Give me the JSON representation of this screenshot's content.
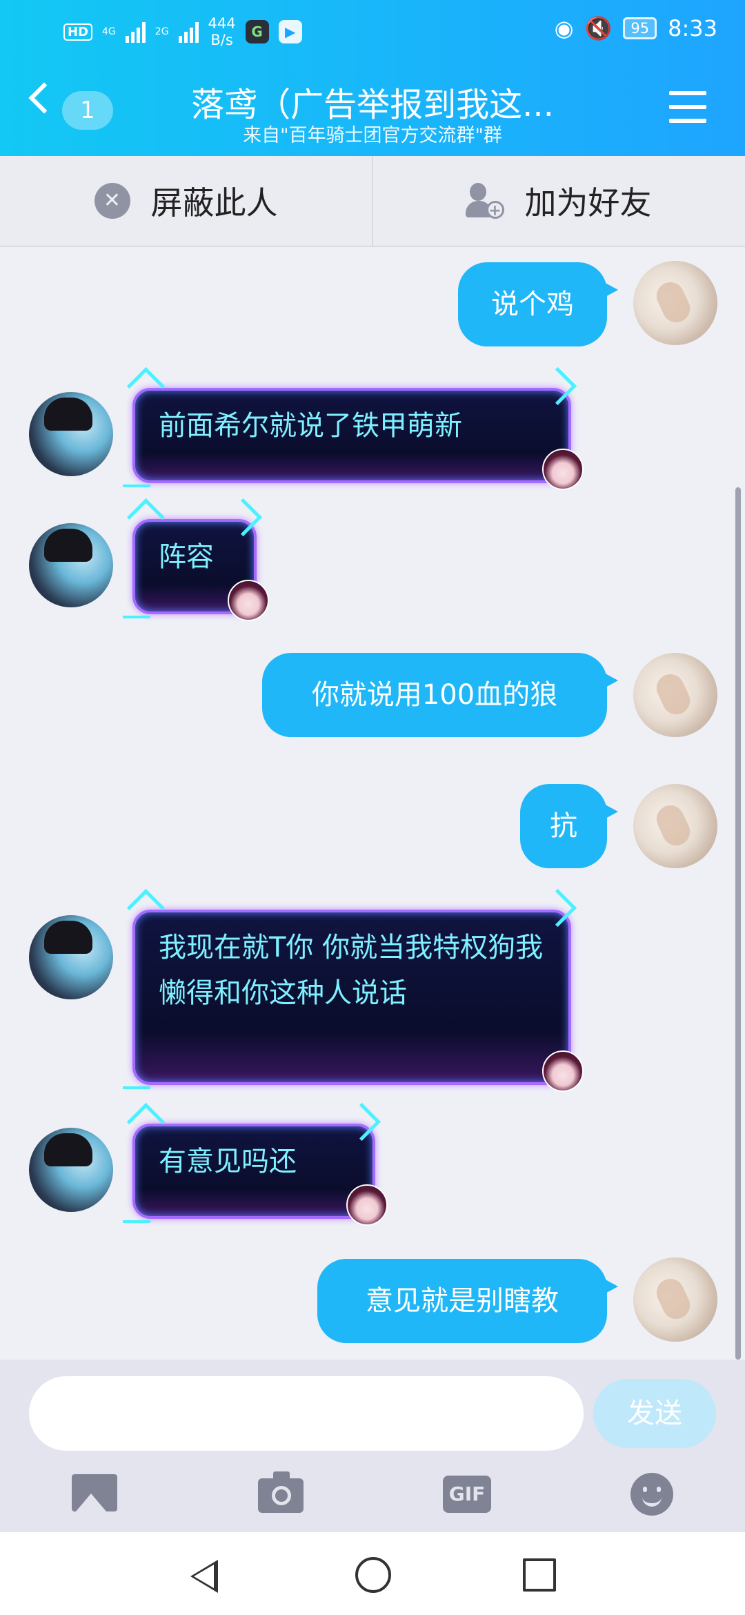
{
  "status": {
    "hd": "HD",
    "net1": "4G",
    "net2": "2G",
    "speed_value": "444",
    "speed_unit": "B/s",
    "app1": "G",
    "battery": "95",
    "time": "8:33"
  },
  "header": {
    "unread_count": "1",
    "title": "落鸢（广告举报到我这...",
    "subtitle": "来自\"百年骑士团官方交流群\"群"
  },
  "actions": {
    "block": "屏蔽此人",
    "add_friend": "加为好友"
  },
  "messages": [
    {
      "from": "me",
      "text": "说个鸡"
    },
    {
      "from": "them",
      "text": "前面希尔就说了铁甲萌新"
    },
    {
      "from": "them",
      "text": "阵容"
    },
    {
      "from": "me",
      "text": "你就说用100血的狼"
    },
    {
      "from": "me",
      "text": "抗"
    },
    {
      "from": "them",
      "text": "我现在就T你 你就当我特权狗我懒得和你这种人说话"
    },
    {
      "from": "them",
      "text": "有意见吗还"
    },
    {
      "from": "me",
      "text": "意见就是别瞎教"
    }
  ],
  "composer": {
    "placeholder": "",
    "send": "发送",
    "gif": "GIF"
  },
  "colors": {
    "header_start": "#13c8f4",
    "header_end": "#1ea5ff",
    "my_bubble": "#1fb7f8",
    "their_text": "#7ff0ff"
  }
}
